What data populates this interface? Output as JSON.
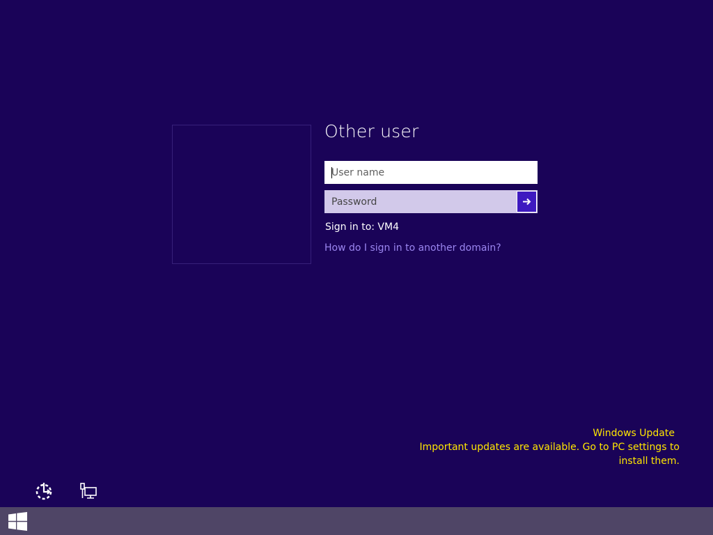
{
  "login": {
    "title": "Other user",
    "username_placeholder": "User name",
    "password_placeholder": "Password",
    "sign_in_to": "Sign in to: VM4",
    "domain_help_link": "How do I sign in to another domain?",
    "submit_icon": "arrow-right-icon"
  },
  "notification": {
    "title": "Windows Update",
    "line1": "Important updates are available. Go to PC settings to",
    "line2": "install them."
  },
  "bottom_icons": {
    "ease_of_access": "ease-of-access-icon",
    "network": "network-icon"
  },
  "taskbar": {
    "start_icon": "windows-logo-icon"
  },
  "colors": {
    "background": "#1a0358",
    "accent": "#3e1ac0",
    "link": "#9b86f0",
    "notification": "#ffe600",
    "taskbar": "#4f4566"
  }
}
